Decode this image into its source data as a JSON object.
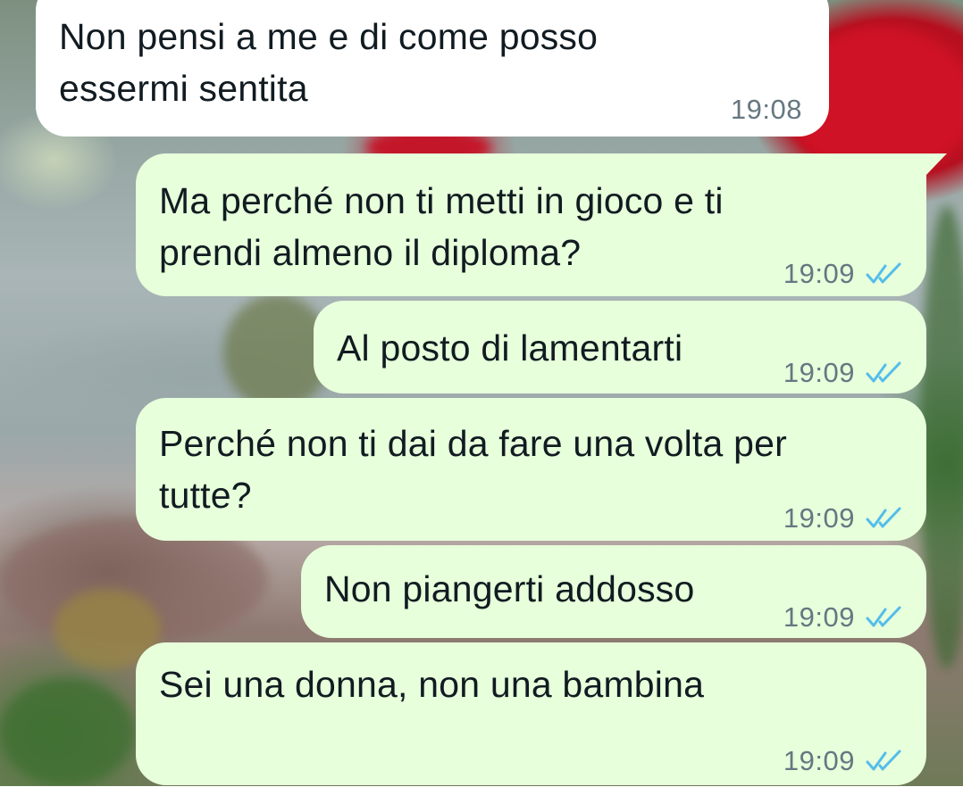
{
  "colors": {
    "incoming_bubble": "#ffffff",
    "outgoing_bubble": "#e7ffdb",
    "timestamp": "#667781",
    "read_ticks": "#53bdeb",
    "text": "#111b21"
  },
  "wallpaper": {
    "description_icon": "red-roses-photo-wallpaper"
  },
  "messages": [
    {
      "direction": "incoming",
      "text": "Non pensi a me e di come posso\nessermi sentita",
      "time": "19:08",
      "status_icon": ""
    },
    {
      "direction": "outgoing",
      "text": "Ma perché non ti metti in gioco e ti\nprendi almeno il diploma?",
      "time": "19:09",
      "status_icon": "double-check-read-icon"
    },
    {
      "direction": "outgoing",
      "text": "Al posto di lamentarti",
      "time": "19:09",
      "status_icon": "double-check-read-icon"
    },
    {
      "direction": "outgoing",
      "text": "Perché non ti dai da fare una volta per\ntutte?",
      "time": "19:09",
      "status_icon": "double-check-read-icon"
    },
    {
      "direction": "outgoing",
      "text": "Non piangerti addosso",
      "time": "19:09",
      "status_icon": "double-check-read-icon"
    },
    {
      "direction": "outgoing",
      "text": "Sei una donna, non una bambina",
      "time": "19:09",
      "status_icon": "double-check-read-icon"
    }
  ]
}
